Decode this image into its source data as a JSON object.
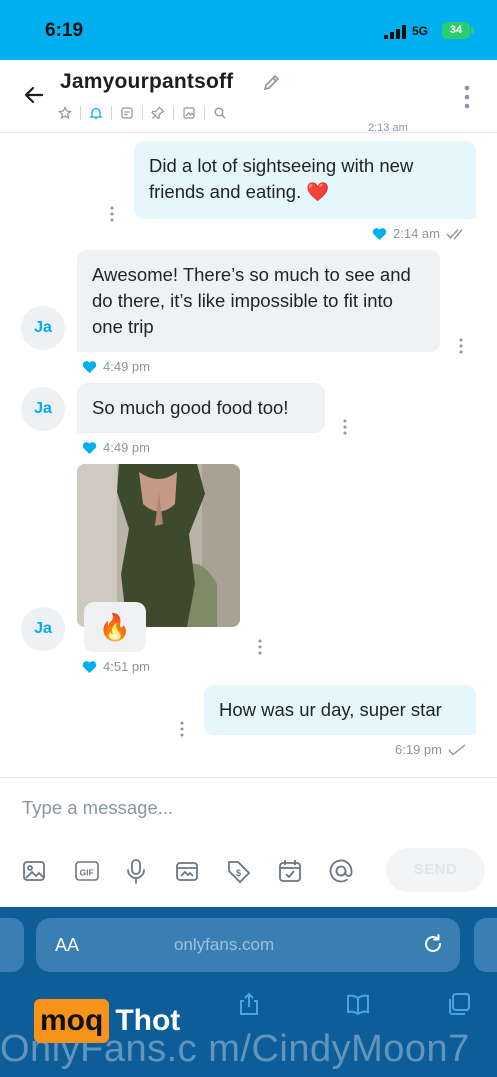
{
  "status_bar": {
    "time": "6:19",
    "network": "5G",
    "battery": "34"
  },
  "header": {
    "title": "Jamyourpantsoff",
    "cut_meta": "2:13 am"
  },
  "messages": [
    {
      "direction": "out",
      "text": "Did a lot of sightseeing with new friends and eating. ❤️",
      "time": "2:14 am",
      "read": true
    },
    {
      "direction": "in",
      "avatar": "Ja",
      "text": "Awesome! There’s so much to see and do there, it’s like impossible to fit into one trip",
      "time": "4:49 pm"
    },
    {
      "direction": "in",
      "avatar": "Ja",
      "text": "So much good food too!",
      "time": "4:49 pm"
    },
    {
      "direction": "in",
      "avatar": "Ja",
      "media": "photo",
      "emoji": "🔥",
      "time": "4:51 pm"
    },
    {
      "direction": "out",
      "text": "How was ur day, super star",
      "time": "6:19 pm",
      "read": false
    }
  ],
  "composer": {
    "placeholder": "Type a message...",
    "send_label": "SEND",
    "tools": [
      "image-icon",
      "gif-icon",
      "microphone-icon",
      "vault-icon",
      "price-tag-icon",
      "calendar-icon",
      "mention-icon"
    ]
  },
  "browser": {
    "aa_label": "AA",
    "url": "onlyfans.com"
  },
  "overlay": {
    "logo_box": "moq",
    "logo_text": "Thot",
    "watermark": "OnlyFans.c m/CindyMoon7"
  },
  "colors": {
    "accent": "#00aff0",
    "outgoing_bubble": "#e6f6fd",
    "incoming_bubble": "#f0f1f3",
    "browser_bar": "#0d5d99"
  }
}
